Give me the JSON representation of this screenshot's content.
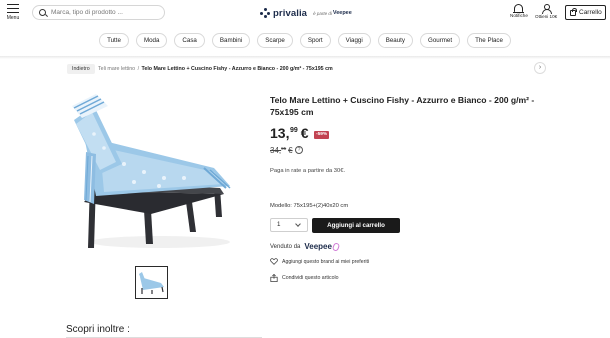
{
  "header": {
    "menu_label": "Menu",
    "search_placeholder": "Marca, tipo di prodotto ...",
    "brand_name": "privalia",
    "brand_part": "è parte di",
    "brand_parent": "Veepee",
    "notifications_label": "Notifiche",
    "account_label": "Ottieni 10€",
    "cart_label": "Carrello"
  },
  "categories": [
    "Tutte",
    "Moda",
    "Casa",
    "Bambini",
    "Scarpe",
    "Sport",
    "Viaggi",
    "Beauty",
    "Gourmet",
    "The Place"
  ],
  "breadcrumb": {
    "back_label": "Indietro",
    "parent": "Teli mare lettino",
    "separator": "/",
    "current": "Telo Mare Lettino + Cuscino Fishy - Azzurro e Bianco - 200 g/m² - 75x195 cm"
  },
  "product": {
    "title": "Telo Mare Lettino + Cuscino Fishy - Azzurro e Bianco - 200 g/m² - 75x195 cm",
    "price_int": "13,",
    "price_dec": "99",
    "price_currency": "€",
    "discount": "-59%",
    "old_price_int": "34,",
    "old_price_dec": "95",
    "old_price_currency": "€",
    "installments": "Paga in rate a partire da 30€.",
    "model": "Modello: 75x195+(2)40x20 cm",
    "quantity": "1",
    "add_to_cart": "Aggiungi al carrello",
    "sold_by": "Venduto da",
    "seller": "Veepee",
    "favorite_brand": "Aggiungi questo brand ai miei preferiti",
    "share": "Condividi questo articolo"
  },
  "discover_title": "Scopri inoltre :",
  "colors": {
    "brand_navy": "#1c2b4a",
    "discount_red": "#c24352",
    "button_black": "#1a1a1a",
    "towel_blue": "#9cc8e8",
    "lounger_frame": "#2f3035"
  },
  "icons": [
    "menu-icon",
    "search-icon",
    "privalia-logo-icon",
    "bell-icon",
    "user-icon",
    "bag-icon",
    "chevron-right-icon",
    "info-icon",
    "chevron-down-icon",
    "heart-icon",
    "share-icon"
  ]
}
